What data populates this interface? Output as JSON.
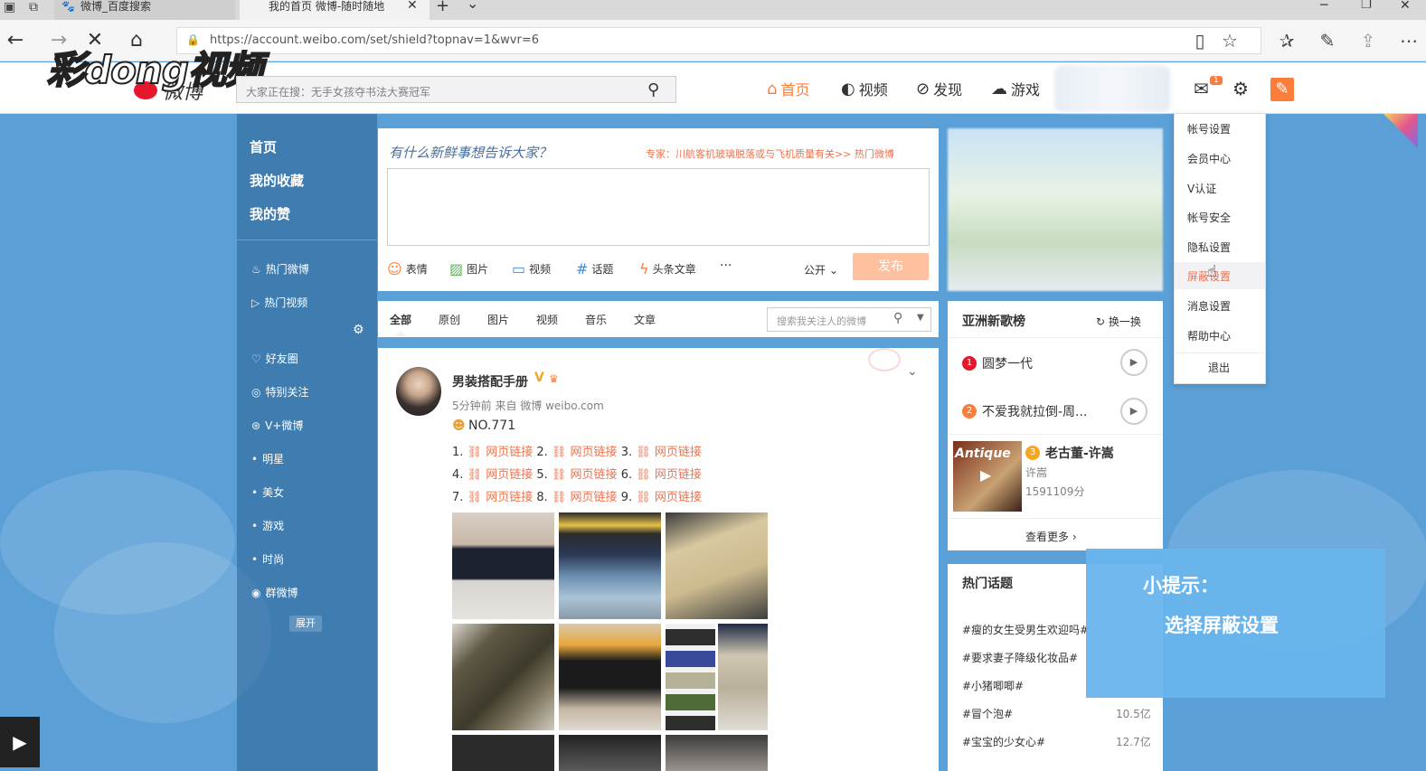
{
  "browser": {
    "tab1_title": "微博_百度搜索",
    "tab2_title": "我的首页 微博-随时随地",
    "url": "https://account.weibo.com/set/shield?topnav=1&wvr=6",
    "tab_close": "✕",
    "tab_add": "+",
    "tab_menu": "⌄"
  },
  "watermark": {
    "text": "彩dong视频"
  },
  "header": {
    "logo_text": "微博",
    "search_placeholder": "大家正在搜：无手女孩夺书法大赛冠军",
    "nav": [
      {
        "label": "首页",
        "icon": "home-icon"
      },
      {
        "label": "视频",
        "icon": "video-icon"
      },
      {
        "label": "发现",
        "icon": "compass-icon"
      },
      {
        "label": "游戏",
        "icon": "gamepad-icon"
      }
    ],
    "msg_badge": "1"
  },
  "sidebar": {
    "main": [
      "首页",
      "我的收藏",
      "我的赞"
    ],
    "items": [
      "热门微博",
      "热门视频",
      "好友圈",
      "特别关注",
      "V+微博",
      "明星",
      "美女",
      "游戏",
      "时尚",
      "群微博"
    ],
    "expand": "展开"
  },
  "composer": {
    "prompt": "有什么新鲜事想告诉大家？",
    "expert": "专家：川航客机玻璃脱落或与飞机质量有关>>  热门微博",
    "tools": [
      "表情",
      "图片",
      "视频",
      "话题",
      "头条文章"
    ],
    "more": "···",
    "visibility": "公开",
    "publish": "发布"
  },
  "filter": {
    "tabs": [
      "全部",
      "原创",
      "图片",
      "视频",
      "音乐",
      "文章"
    ],
    "search_placeholder": "搜索我关注人的微博"
  },
  "post": {
    "author": "男装搭配手册",
    "verify": "V",
    "meta": "5分钟前 来自 微博 weibo.com",
    "title": "NO.771",
    "link_label": "网页链接",
    "nums": [
      "1.",
      "2.",
      "3.",
      "4.",
      "5.",
      "6.",
      "7.",
      "8.",
      "9."
    ]
  },
  "music": {
    "title": "亚洲新歌榜",
    "refresh": "换一换",
    "songs": [
      "圆梦一代",
      "不爱我就拉倒-周..."
    ],
    "song3_title": "老古董-许嵩",
    "song3_artist": "许嵩",
    "song3_score": "1591109分",
    "album_text": "Antique",
    "more": "查看更多"
  },
  "hot_topics": {
    "title": "热门话题",
    "items": [
      {
        "name": "#瘦的女生受男生欢迎吗#",
        "count": ""
      },
      {
        "name": "#要求妻子降级化妆品#",
        "count": ""
      },
      {
        "name": "#小猪唧唧#",
        "count": ""
      },
      {
        "name": "#冒个泡#",
        "count": "10.5亿"
      },
      {
        "name": "#宝宝的少女心#",
        "count": "12.7亿"
      }
    ]
  },
  "dropdown": {
    "items": [
      "帐号设置",
      "会员中心",
      "V认证",
      "帐号安全",
      "隐私设置",
      "屏蔽设置",
      "消息设置",
      "帮助中心",
      "退出"
    ]
  },
  "tip": {
    "label": "小提示：",
    "text": "选择屏蔽设置"
  }
}
